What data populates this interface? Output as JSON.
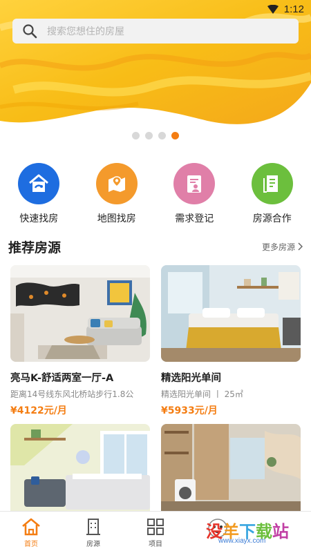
{
  "status_bar": {
    "time": "1:12"
  },
  "search": {
    "placeholder": "搜索您想住的房屋"
  },
  "banner": {
    "page_count": 4,
    "active_page": 4
  },
  "quick_entries": [
    {
      "label": "快速找房",
      "icon": "house-search-icon",
      "color": "#1e6de0"
    },
    {
      "label": "地图找房",
      "icon": "map-pin-icon",
      "color": "#f49a2c"
    },
    {
      "label": "需求登记",
      "icon": "register-icon",
      "color": "#e07fa8"
    },
    {
      "label": "房源合作",
      "icon": "cooperation-icon",
      "color": "#6cbf3d"
    }
  ],
  "recommend": {
    "title": "推荐房源",
    "more": "更多房源"
  },
  "listings": [
    {
      "title": "亮马K-舒适两室一厅-A",
      "subtitle": "距离14号线东风北桥站步行1.8公",
      "price": "¥4122元/月"
    },
    {
      "title": "精选阳光单间",
      "subtitle": "精选阳光单间 丨 25㎡",
      "price": "¥5933元/月"
    }
  ],
  "bottom_nav": [
    {
      "label": "首页",
      "icon": "home-icon",
      "active": true
    },
    {
      "label": "房源",
      "icon": "building-icon",
      "active": false
    },
    {
      "label": "项目",
      "icon": "grid-icon",
      "active": false
    },
    {
      "label": "",
      "icon": "mascot-icon",
      "active": false
    }
  ],
  "watermark": {
    "text": "没羊下载站",
    "sub": "www.xiayx.com"
  },
  "colors": {
    "accent": "#f47d12",
    "banner": "#f7c21a"
  }
}
